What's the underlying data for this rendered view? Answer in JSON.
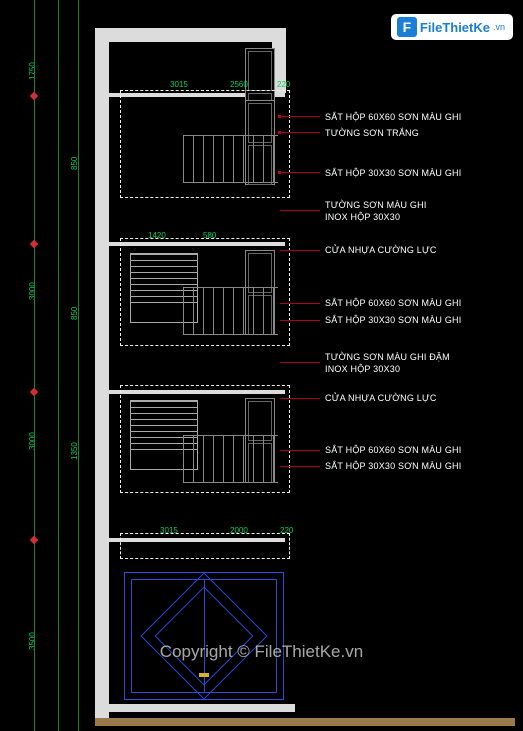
{
  "watermark": {
    "brand_prefix": "File",
    "brand_main": "ThietKe",
    "brand_suffix": ".vn",
    "copyright": "Copyright © FileThietKe.vn"
  },
  "annotations": {
    "a1": "SẮT HỘP 60X60 SƠN MÀU GHI",
    "a2": "TƯỜNG SƠN TRẮNG",
    "a3": "SẮT HỘP 30X30 SƠN MÀU GHI",
    "a4": "TƯỜNG SƠN MÀU GHI",
    "a5": "INOX HỘP 30X30",
    "a6": "CỬA NHỰA CƯỜNG LỰC",
    "a7": "SẮT HỘP 60X60 SƠN MÀU GHI",
    "a8": "SẮT HỘP 30X30 SƠN MÀU GHI",
    "a9": "TƯỜNG SƠN MÀU GHI ĐẬM",
    "a10": "INOX HỘP 30X30",
    "a11": "CỬA NHỰA CƯỜNG LỰC",
    "a12": "SẮT HỘP 60X60 SƠN MÀU GHI",
    "a13": "SẮT HỘP 30X30 SƠN MÀU GHI"
  },
  "dimensions": {
    "top_w": "3015",
    "d1": "2560",
    "d2": "220",
    "mid1": "1420",
    "mid2": "580",
    "g1": "3015",
    "g2": "2000",
    "g3": "220",
    "v_top": "1750",
    "v_block": "1350",
    "v_rail": "850",
    "v_mid": "3000",
    "v_ground": "3500"
  },
  "colors": {
    "bg": "#000000",
    "wall": "#dcdcdc",
    "annotation_text": "#ffffff",
    "leader": "#b00020",
    "dim_text": "#00d060",
    "gate": "#2a4bd8"
  }
}
